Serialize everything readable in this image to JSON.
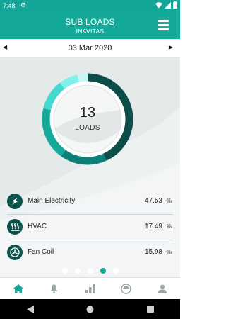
{
  "status_bar": {
    "time": "7:48"
  },
  "header": {
    "title": "SUB LOADS",
    "subtitle": "INAVITAS"
  },
  "date_bar": {
    "date": "03 Mar 2020"
  },
  "summary": {
    "count": "13",
    "label": "LOADS"
  },
  "loads": [
    {
      "name": "Main Electricity",
      "value": "47.53",
      "unit": "%",
      "icon": "lightning-bolt-icon"
    },
    {
      "name": "HVAC",
      "value": "17.49",
      "unit": "%",
      "icon": "heat-waves-icon"
    },
    {
      "name": "Fan Coil",
      "value": "15.98",
      "unit": "%",
      "icon": "fan-icon"
    }
  ],
  "pager": {
    "count": 5,
    "active_index": 3
  },
  "bottom_nav": [
    {
      "icon": "home-icon",
      "active": true
    },
    {
      "icon": "bell-icon",
      "active": false
    },
    {
      "icon": "bar-chart-icon",
      "active": false
    },
    {
      "icon": "gauge-icon",
      "active": false
    },
    {
      "icon": "user-icon",
      "active": false
    }
  ],
  "colors": {
    "primary": "#15a99a",
    "primary_dark": "#0e524d",
    "accent_light": "#5ee7e0",
    "background": "#e4e9ea"
  }
}
